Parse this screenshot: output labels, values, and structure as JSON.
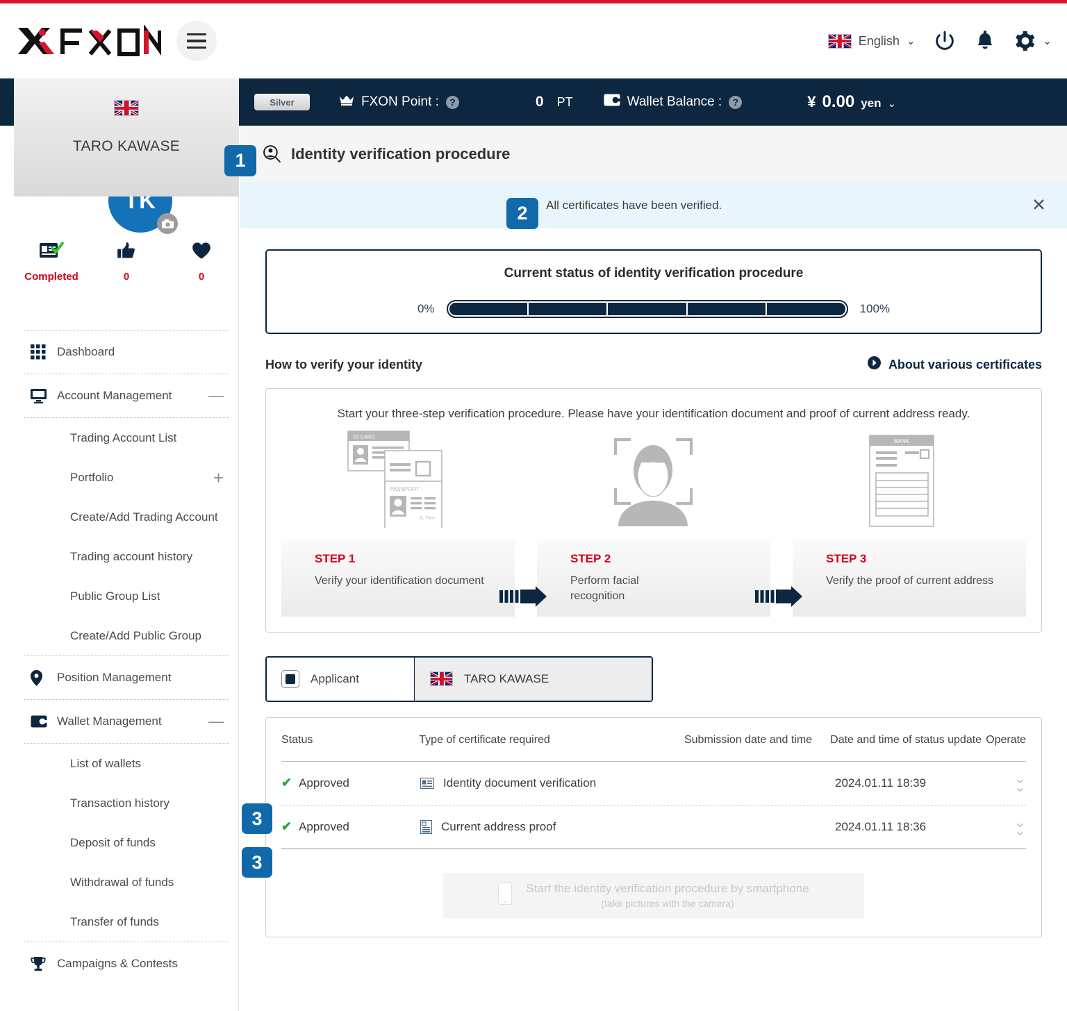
{
  "header": {
    "logo_text": "FXON",
    "menu_icon": "hamburger-icon",
    "language": "English",
    "icons": [
      "power-icon",
      "bell-icon",
      "gear-icon"
    ]
  },
  "account_strip": {
    "tier": "Silver",
    "point_label": "FXON Point :",
    "point_value": "0",
    "point_unit": "PT",
    "wallet_label": "Wallet Balance :",
    "currency_symbol": "¥",
    "wallet_value": "0.00",
    "wallet_unit": "yen"
  },
  "sidebar": {
    "user_name": "TARO KAWASE",
    "avatar_initials": "TK",
    "stats": [
      {
        "icon": "id-verified-icon",
        "label": "Completed"
      },
      {
        "icon": "thumbs-up-icon",
        "label": "0"
      },
      {
        "icon": "heart-icon",
        "label": "0"
      }
    ],
    "items": [
      {
        "label": "Dashboard",
        "icon": "grid-icon",
        "expand": ""
      },
      {
        "label": "Account Management",
        "icon": "monitor-icon",
        "expand": "—"
      },
      {
        "label": "Position Management",
        "icon": "pin-icon",
        "expand": ""
      },
      {
        "label": "Wallet Management",
        "icon": "wallet-icon",
        "expand": "—"
      },
      {
        "label": "Campaigns & Contests",
        "icon": "trophy-icon",
        "expand": ""
      }
    ],
    "account_sub": [
      {
        "label": "Trading Account List",
        "plus": ""
      },
      {
        "label": "Portfolio",
        "plus": "+"
      },
      {
        "label": "Create/Add Trading Account",
        "plus": ""
      },
      {
        "label": "Trading account history",
        "plus": ""
      },
      {
        "label": "Public Group List",
        "plus": ""
      },
      {
        "label": "Create/Add Public Group",
        "plus": ""
      }
    ],
    "wallet_sub": [
      {
        "label": "List of wallets"
      },
      {
        "label": "Transaction history"
      },
      {
        "label": "Deposit of funds"
      },
      {
        "label": "Withdrawal of funds"
      },
      {
        "label": "Transfer of funds"
      }
    ]
  },
  "page": {
    "title": "Identity verification procedure",
    "title_icon": "identity-search-icon",
    "notice": "All certificates have been verified.",
    "notice_close": "✕"
  },
  "status": {
    "title": "Current status of identity verification procedure",
    "min_label": "0%",
    "max_label": "100%",
    "segments_total": 5,
    "segments_filled": 5
  },
  "howto": {
    "heading": "How to verify your identity",
    "link": "About various certificates",
    "lead": "Start your three-step verification procedure. Please have your identification document and proof of current address ready.",
    "steps": [
      {
        "number": "STEP 1",
        "desc": "Verify your identification document",
        "art": "id-card-passport-art",
        "art_labels": [
          "ID CARD",
          "PASSPORT",
          "K, Tiro"
        ]
      },
      {
        "number": "STEP 2",
        "desc": "Perform facial recognition",
        "art": "face-scan-art",
        "art_labels": []
      },
      {
        "number": "STEP 3",
        "desc": "Verify the proof of current address",
        "art": "bank-statement-art",
        "art_labels": [
          "BANK"
        ]
      }
    ]
  },
  "applicant": {
    "label": "Applicant",
    "name": "TARO KAWASE"
  },
  "table": {
    "columns": [
      "Status",
      "Type of certificate required",
      "Submission date and time",
      "Date and time of status update",
      "Operate"
    ],
    "rows": [
      {
        "status": "Approved",
        "type": "Identity document verification",
        "type_icon": "id-card-icon",
        "submitted": "",
        "updated": "2024.01.11 18:39",
        "operate_icon": "double-chevron-down-icon"
      },
      {
        "status": "Approved",
        "type": "Current address proof",
        "type_icon": "document-icon",
        "submitted": "",
        "updated": "2024.01.11 18:36",
        "operate_icon": "double-chevron-down-icon"
      }
    ]
  },
  "smartphone_button": {
    "title": "Start the identity verification procedure by smartphone",
    "subtitle": "(take pictures with the camera)",
    "icon": "smartphone-icon"
  },
  "annotations": [
    {
      "id": "1",
      "text": "1"
    },
    {
      "id": "2",
      "text": "2"
    },
    {
      "id": "3a",
      "text": "3"
    },
    {
      "id": "3b",
      "text": "3"
    }
  ],
  "colors": {
    "accent_red": "#d8142c",
    "navy": "#0d2740",
    "badge_blue": "#1169aa",
    "avatar_blue": "#1473b8",
    "approved_green": "#2aa535",
    "notice_bg": "#e8f5fd"
  }
}
